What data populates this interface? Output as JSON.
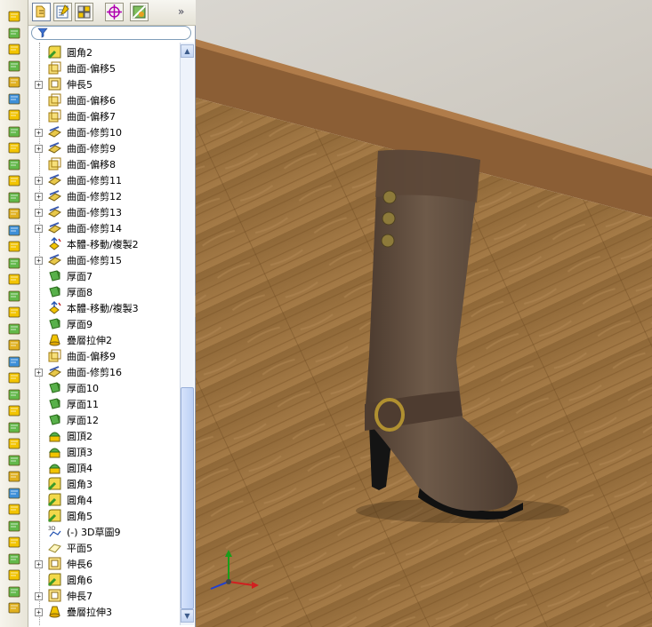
{
  "panel": {
    "tabs": [
      "feature-manager-tab",
      "property-manager-tab",
      "configuration-manager-tab",
      "dimxpert-tab",
      "display-manager-tab"
    ],
    "more_glyph": "»",
    "filter_icon": "funnel-icon"
  },
  "toolbar_icons": [
    "extruded-boss-icon",
    "revolved-boss-icon",
    "swept-boss-icon",
    "lofted-boss-icon",
    "boundary-boss-icon",
    "extruded-cut-icon",
    "hole-wizard-icon",
    "revolved-cut-icon",
    "swept-cut-icon",
    "lofted-cut-icon",
    "boundary-cut-icon",
    "fillet-icon",
    "linear-pattern-icon",
    "rib-icon",
    "draft-icon",
    "shell-icon",
    "wrap-icon",
    "dome-icon",
    "mirror-icon",
    "reference-geometry-icon",
    "curves-icon",
    "instant3d-icon",
    "sketch-icon",
    "smart-dimension-icon",
    "rapid-sketch-icon",
    "move-icon",
    "pattern-icon",
    "scale-icon",
    "split-icon",
    "combine-icon",
    "intersect-icon",
    "indent-icon",
    "flex-icon",
    "freeform-icon",
    "deform-icon",
    "thicken-icon",
    "copy-icon"
  ],
  "tree": [
    {
      "label": "圓角2",
      "icon": "fillet",
      "expander": false
    },
    {
      "label": "曲面-偏移5",
      "icon": "offset",
      "expander": false
    },
    {
      "label": "伸長5",
      "icon": "extend",
      "expander": true
    },
    {
      "label": "曲面-偏移6",
      "icon": "offset",
      "expander": false
    },
    {
      "label": "曲面-偏移7",
      "icon": "offset",
      "expander": false
    },
    {
      "label": "曲面-修剪10",
      "icon": "trim",
      "expander": true
    },
    {
      "label": "曲面-修剪9",
      "icon": "trim",
      "expander": true
    },
    {
      "label": "曲面-偏移8",
      "icon": "offset",
      "expander": false
    },
    {
      "label": "曲面-修剪11",
      "icon": "trim",
      "expander": true
    },
    {
      "label": "曲面-修剪12",
      "icon": "trim",
      "expander": true
    },
    {
      "label": "曲面-修剪13",
      "icon": "trim",
      "expander": true
    },
    {
      "label": "曲面-修剪14",
      "icon": "trim",
      "expander": true
    },
    {
      "label": "本體-移動/複製2",
      "icon": "move",
      "expander": false
    },
    {
      "label": "曲面-修剪15",
      "icon": "trim",
      "expander": true
    },
    {
      "label": "厚面7",
      "icon": "thicken",
      "expander": false
    },
    {
      "label": "厚面8",
      "icon": "thicken",
      "expander": false
    },
    {
      "label": "本體-移動/複製3",
      "icon": "move",
      "expander": false
    },
    {
      "label": "厚面9",
      "icon": "thicken",
      "expander": false
    },
    {
      "label": "疊層拉伸2",
      "icon": "loft",
      "expander": false
    },
    {
      "label": "曲面-偏移9",
      "icon": "offset",
      "expander": false
    },
    {
      "label": "曲面-修剪16",
      "icon": "trim",
      "expander": true
    },
    {
      "label": "厚面10",
      "icon": "thicken",
      "expander": false
    },
    {
      "label": "厚面11",
      "icon": "thicken",
      "expander": false
    },
    {
      "label": "厚面12",
      "icon": "thicken",
      "expander": false
    },
    {
      "label": "圓頂2",
      "icon": "dome",
      "expander": false
    },
    {
      "label": "圓頂3",
      "icon": "dome",
      "expander": false
    },
    {
      "label": "圓頂4",
      "icon": "dome",
      "expander": false
    },
    {
      "label": "圓角3",
      "icon": "fillet",
      "expander": false
    },
    {
      "label": "圓角4",
      "icon": "fillet",
      "expander": false
    },
    {
      "label": "圓角5",
      "icon": "fillet",
      "expander": false
    },
    {
      "label": "(-) 3D草圖9",
      "icon": "sketch3d",
      "expander": false
    },
    {
      "label": "平面5",
      "icon": "plane",
      "expander": false
    },
    {
      "label": "伸長6",
      "icon": "extend",
      "expander": true
    },
    {
      "label": "圓角6",
      "icon": "fillet",
      "expander": false
    },
    {
      "label": "伸長7",
      "icon": "extend",
      "expander": true
    },
    {
      "label": "疊層拉伸3",
      "icon": "loft",
      "expander": true
    }
  ],
  "scrollbar": {
    "up_glyph": "▲",
    "down_glyph": "▼"
  },
  "splitter_glyph": "‹‹",
  "viewport": {
    "triad": "view-triad-icon"
  },
  "colors": {
    "accent": "#f2c400",
    "wall": "#d7d3cb",
    "floor": "#9a6f3d",
    "boot": "#5e4a3b"
  }
}
